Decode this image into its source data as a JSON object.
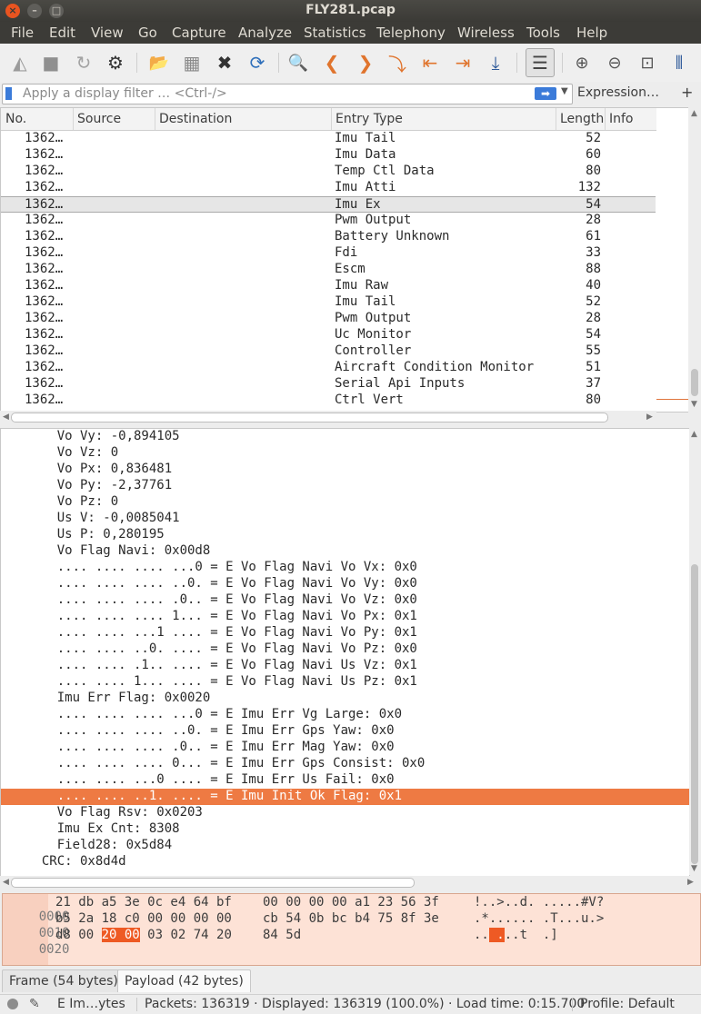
{
  "window": {
    "title": "FLY281.pcap",
    "controls": {
      "close": "×",
      "minimize": "–",
      "maximize": "□"
    }
  },
  "menu": [
    "File",
    "Edit",
    "View",
    "Go",
    "Capture",
    "Analyze",
    "Statistics",
    "Telephony",
    "Wireless",
    "Tools",
    "Help"
  ],
  "toolbar": {
    "icons": [
      "shark-fin-start-icon",
      "stop-icon",
      "restart-icon",
      "gear-options-icon",
      "open-file-icon",
      "save-file-icon",
      "close-file-icon",
      "reload-icon",
      "find-icon",
      "back-icon",
      "forward-icon",
      "goto-packet-icon",
      "first-packet-icon",
      "last-packet-icon",
      "autoscroll-icon",
      "colorize-icon",
      "zoom-in-icon",
      "zoom-out-icon",
      "normal-size-icon",
      "resize-columns-icon"
    ],
    "glyphs": [
      "◭",
      "■",
      "↻",
      "⚙",
      "📂",
      "▦",
      "✖",
      "⟳",
      "🔍",
      "❮",
      "❯",
      "⤵",
      "⇤",
      "⇥",
      "⤓",
      "☰",
      "⊕",
      "⊖",
      "⊡",
      "⫴"
    ]
  },
  "filter": {
    "placeholder": "Apply a display filter … <Ctrl-/>",
    "apply_glyph": "➡",
    "dropdown_glyph": "▼",
    "expression_label": "Expression…",
    "add_label": "+"
  },
  "packet_list": {
    "columns": [
      "No.",
      "Source",
      "Destination",
      "Entry Type",
      "Length",
      "Info"
    ],
    "selected_index": 4,
    "rows": [
      {
        "no": "1362…",
        "type": "Imu Tail",
        "length": "52"
      },
      {
        "no": "1362…",
        "type": "Imu Data",
        "length": "60"
      },
      {
        "no": "1362…",
        "type": "Temp Ctl Data",
        "length": "80"
      },
      {
        "no": "1362…",
        "type": "Imu Atti",
        "length": "132"
      },
      {
        "no": "1362…",
        "type": "Imu Ex",
        "length": "54"
      },
      {
        "no": "1362…",
        "type": "Pwm Output",
        "length": "28"
      },
      {
        "no": "1362…",
        "type": "Battery Unknown",
        "length": "61"
      },
      {
        "no": "1362…",
        "type": "Fdi",
        "length": "33"
      },
      {
        "no": "1362…",
        "type": "Escm",
        "length": "88"
      },
      {
        "no": "1362…",
        "type": "Imu Raw",
        "length": "40"
      },
      {
        "no": "1362…",
        "type": "Imu Tail",
        "length": "52"
      },
      {
        "no": "1362…",
        "type": "Pwm Output",
        "length": "28"
      },
      {
        "no": "1362…",
        "type": "Uc Monitor",
        "length": "54"
      },
      {
        "no": "1362…",
        "type": "Controller",
        "length": "55"
      },
      {
        "no": "1362…",
        "type": "Aircraft Condition Monitor",
        "length": "51"
      },
      {
        "no": "1362…",
        "type": "Serial Api Inputs",
        "length": "37"
      },
      {
        "no": "1362…",
        "type": "Ctrl Vert",
        "length": "80"
      }
    ]
  },
  "details": {
    "highlight_index": 22,
    "lines": [
      "    Vo Vy: -0,894105",
      "    Vo Vz: 0",
      "    Vo Px: 0,836481",
      "    Vo Py: -2,37761",
      "    Vo Pz: 0",
      "    Us V: -0,0085041",
      "    Us P: 0,280195",
      "    Vo Flag Navi: 0x00d8",
      "    .... .... .... ...0 = E Vo Flag Navi Vo Vx: 0x0",
      "    .... .... .... ..0. = E Vo Flag Navi Vo Vy: 0x0",
      "    .... .... .... .0.. = E Vo Flag Navi Vo Vz: 0x0",
      "    .... .... .... 1... = E Vo Flag Navi Vo Px: 0x1",
      "    .... .... ...1 .... = E Vo Flag Navi Vo Py: 0x1",
      "    .... .... ..0. .... = E Vo Flag Navi Vo Pz: 0x0",
      "    .... .... .1.. .... = E Vo Flag Navi Us Vz: 0x1",
      "    .... .... 1... .... = E Vo Flag Navi Us Pz: 0x1",
      "    Imu Err Flag: 0x0020",
      "    .... .... .... ...0 = E Imu Err Vg Large: 0x0",
      "    .... .... .... ..0. = E Imu Err Gps Yaw: 0x0",
      "    .... .... .... .0.. = E Imu Err Mag Yaw: 0x0",
      "    .... .... .... 0... = E Imu Err Gps Consist: 0x0",
      "    .... .... ...0 .... = E Imu Err Us Fail: 0x0",
      "    .... .... ..1. .... = E Imu Init Ok Flag: 0x1",
      "    Vo Flag Rsv: 0x0203",
      "    Imu Ex Cnt: 8308",
      "    Field28: 0x5d84",
      "  CRC: 0x8d4d"
    ]
  },
  "bytes": {
    "rows": [
      {
        "offset": "0000",
        "hex_a": "21 db a5 3e 0c e4 64 bf",
        "hex_b": "00 00 00 00 a1 23 56 3f",
        "ascii": "!..>..d. .....#V?"
      },
      {
        "offset": "0010",
        "hex_a": "b5 2a 18 c0 00 00 00 00",
        "hex_b": "cb 54 0b bc b4 75 8f 3e",
        "ascii": ".*...... .T...u.>"
      },
      {
        "offset": "0020",
        "hex_pre": "d8 00 ",
        "hex_hl": "20 00",
        "hex_post": " 03 02 74 20",
        "hex_b": "84 5d",
        "ascii_pre": "..",
        "ascii_hl": " .",
        "ascii_post": "..t  .]"
      }
    ]
  },
  "tabs": [
    "Frame (54 bytes)",
    "Payload (42 bytes)"
  ],
  "status": {
    "field": "E Im…ytes",
    "packets": "Packets: 136319 · Displayed: 136319 (100.0%) · Load time: 0:15.700",
    "profile": "Profile: Default"
  }
}
